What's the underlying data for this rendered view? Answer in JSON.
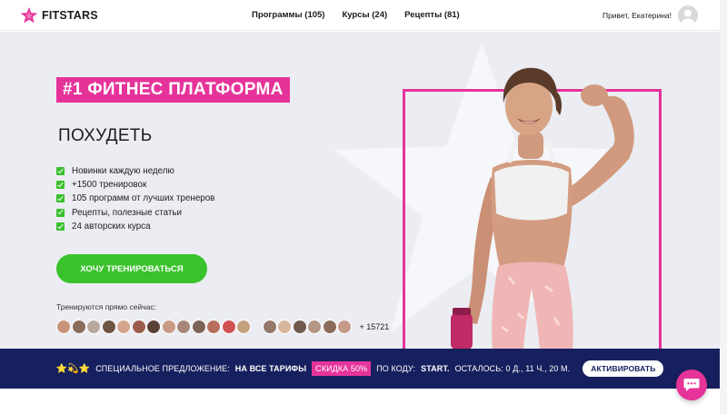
{
  "header": {
    "logo_text": "FITSTARS",
    "nav": [
      "Программы (105)",
      "Курсы (24)",
      "Рецепты (81)"
    ],
    "greeting": "Привет, Екатерина!"
  },
  "hero": {
    "badge": "#1 ФИТНЕС ПЛАТФОРМА",
    "subtitle": "ПОХУДЕТЬ",
    "features": [
      "Новинки каждую неделю",
      "+1500 тренировок",
      "105 программ от лучших тренеров",
      "Рецепты, полезные статьи",
      "24 авторских курса"
    ],
    "cta_label": "ХОЧУ ТРЕНИРОВАТЬСЯ",
    "training_now": "Тренируются прямо сейчас:",
    "training_count": "+ 15721"
  },
  "promo": {
    "stars": "⭐💫⭐",
    "text_prefix": "СПЕЦИАЛЬНОЕ ПРЕДЛОЖЕНИЕ:",
    "text_bold": "НА ВСЕ ТАРИФЫ",
    "discount": "СКИДКА 50%",
    "text_code_prefix": "ПО КОДУ:",
    "code": "START.",
    "remaining": "ОСТАЛОСЬ: 0 Д., 11 Ч., 20 М.",
    "button_label": "АКТИВИРОВАТЬ"
  },
  "colors": {
    "brand_pink": "#e6339a",
    "cta_green": "#3ac22c",
    "promo_navy": "#17205e",
    "hero_bg": "#ebedf2"
  }
}
